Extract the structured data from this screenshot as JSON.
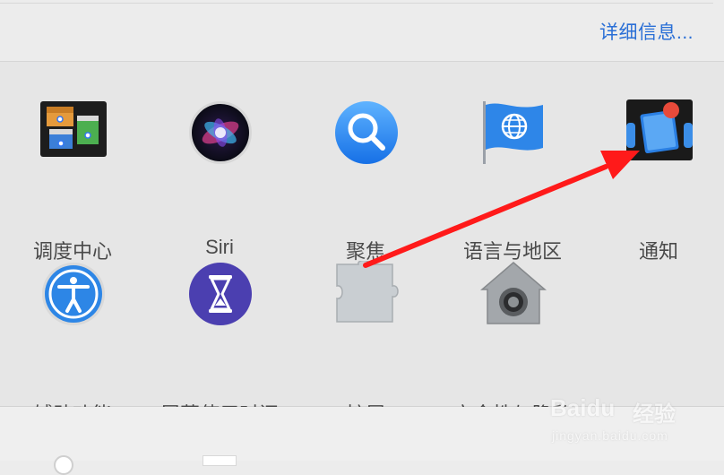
{
  "header": {
    "details_link": "详细信息..."
  },
  "preferences": {
    "row1": [
      {
        "label": "调度中心",
        "icon": "mission-control-icon"
      },
      {
        "label": "Siri",
        "icon": "siri-icon"
      },
      {
        "label": "聚焦",
        "icon": "spotlight-icon"
      },
      {
        "label": "语言与地区",
        "icon": "language-region-icon"
      },
      {
        "label": "通知",
        "icon": "notifications-icon"
      }
    ],
    "row2": [
      {
        "label": "辅助功能",
        "icon": "accessibility-icon"
      },
      {
        "label": "屏幕使用时间",
        "icon": "screen-time-icon"
      },
      {
        "label": "扩展",
        "icon": "extensions-icon"
      },
      {
        "label": "安全性与隐私",
        "icon": "security-privacy-icon"
      }
    ]
  },
  "annotation": {
    "type": "red-arrow",
    "color": "#ff1a1a",
    "points_to": "通知"
  },
  "watermark": {
    "brand": "Baidu",
    "name": "经验",
    "url": "jingyan.baidu.com"
  },
  "colors": {
    "link": "#2a6fd6",
    "label": "#4a4a4a",
    "panel": "#e6e6e6"
  }
}
